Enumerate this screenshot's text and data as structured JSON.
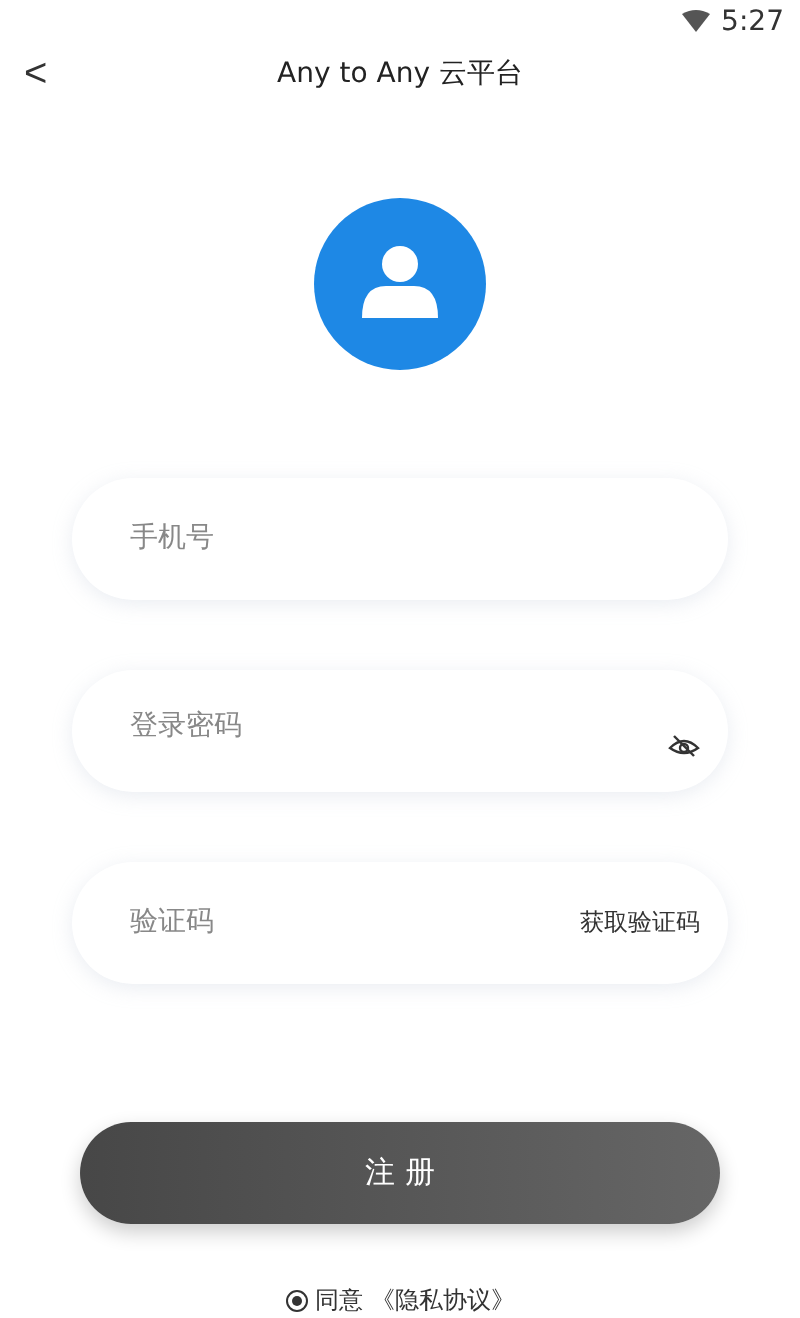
{
  "status_bar": {
    "time": "5:27"
  },
  "header": {
    "back": "<",
    "title": "Any to Any 云平台"
  },
  "fields": [
    {
      "kind": "text",
      "placeholder": "手机号"
    },
    {
      "kind": "password",
      "placeholder": "登录密码",
      "password_visible": false
    },
    {
      "kind": "code",
      "placeholder": "验证码",
      "action": "获取验证码"
    }
  ],
  "submit": "注 册",
  "agreement": {
    "checked": true,
    "text": "同意",
    "link": "《隐私协议》"
  }
}
